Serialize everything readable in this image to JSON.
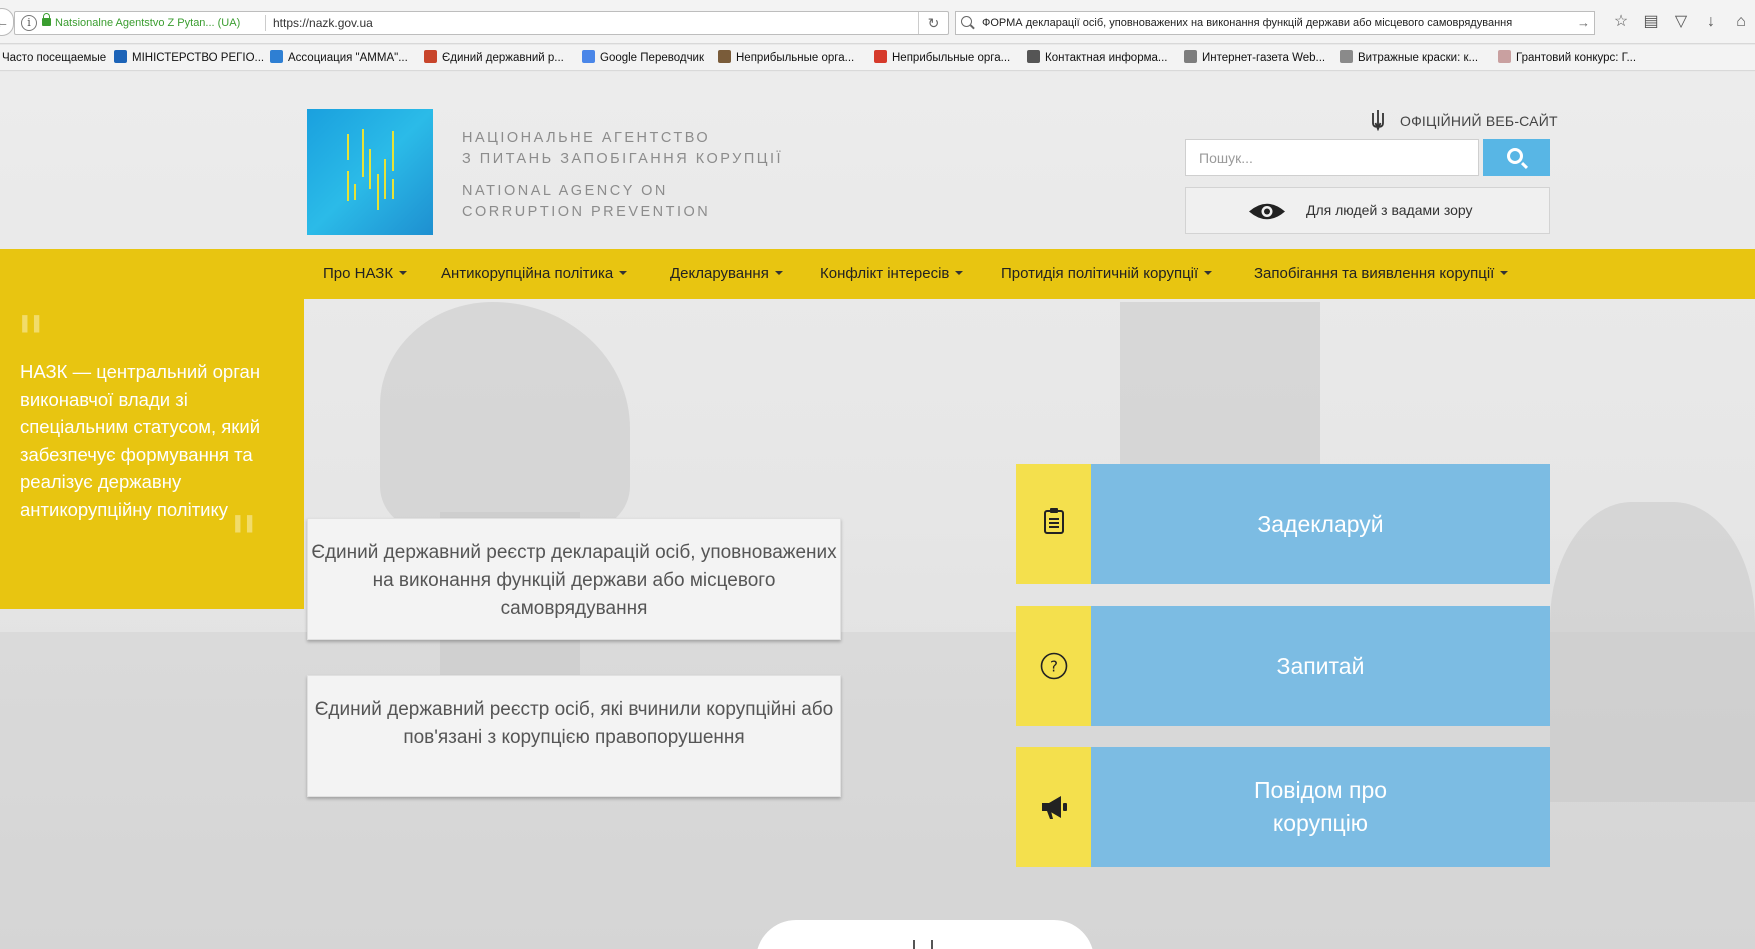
{
  "browser": {
    "back_glyph": "←",
    "site_identity": "Natsionalne Agentstvo Z Pytan... (UA)",
    "url": "https://nazk.gov.ua",
    "reload_glyph": "↻",
    "search_text": "ФОРМА декларації осіб, уповноважених на виконання функцій держави або місцевого самоврядування",
    "search_go": "→",
    "toolbar_icons": [
      {
        "name": "bookmark-star-icon",
        "glyph": "☆"
      },
      {
        "name": "reading-list-icon",
        "glyph": "▤"
      },
      {
        "name": "pocket-icon",
        "glyph": "▽"
      },
      {
        "name": "download-icon",
        "glyph": "↓"
      },
      {
        "name": "home-icon",
        "glyph": "⌂"
      }
    ],
    "bookmarks": [
      {
        "label": "Часто посещаемые",
        "color": ""
      },
      {
        "label": "МІНІСТЕРСТВО РЕГІО...",
        "color": "#1c63b7"
      },
      {
        "label": "Ассоциация \"АММА\"...",
        "color": "#2e7fd3"
      },
      {
        "label": "Єдиний державний р...",
        "color": "#c8452b"
      },
      {
        "label": "Google Переводчик",
        "color": "#4a86e8"
      },
      {
        "label": "Неприбыльные орга...",
        "color": "#7a5c3a"
      },
      {
        "label": "Неприбыльные орга...",
        "color": "#d63a2b"
      },
      {
        "label": "Контактная информа...",
        "color": "#555555"
      },
      {
        "label": "Интернет-газета Web...",
        "color": "#7d7d7d"
      },
      {
        "label": "Витражные краски: к...",
        "color": "#8a8a8a"
      },
      {
        "label": "Грантовий конкурс: Г...",
        "color": "#c9a0a0"
      }
    ]
  },
  "header": {
    "logo_line1": "НАЦІОНАЛЬНЕ АГЕНТСТВО",
    "logo_line2": "З ПИТАНЬ ЗАПОБІГАННЯ КОРУПЦІЇ",
    "logo_line3": "NATIONAL AGENCY ON",
    "logo_line4": "CORRUPTION PREVENTION",
    "official_label": "ОФІЦІЙНИЙ ВЕБ-САЙТ",
    "search_placeholder": "Пошук...",
    "vision_label": "Для людей з вадами зору"
  },
  "nav": {
    "items": [
      "Про НАЗК",
      "Антикорупційна політика",
      "Декларування",
      "Конфлікт інтересів",
      "Протидія політичній корупції",
      "Запобігання та виявлення корупції"
    ]
  },
  "quote": {
    "open_mark": "\"",
    "close_mark": "\"",
    "text": "НАЗК — центральний орган  виконавчої влади зі спеціальним статусом, який забезпечує формування та реалізує державну антикорупційну політику"
  },
  "registries": [
    "Єдиний державний реєстр декларацій осіб, уповноважених на виконання функцій держави або місцевого самоврядування",
    "Єдиний державний реєстр осіб, які вчинили корупційні або пов'язані з корупцією правопорушення"
  ],
  "actions": [
    {
      "label": "Задекларуй",
      "icon": "clipboard-icon"
    },
    {
      "label": "Запитай",
      "icon": "question-circle-icon"
    },
    {
      "label": "Повідом про корупцію",
      "icon": "megaphone-icon"
    }
  ],
  "colors": {
    "brand_yellow": "#e8c511",
    "action_blue": "#7cbce3",
    "action_yellow": "#f4e04d",
    "search_blue": "#58b6e5",
    "logo_blue": "#1aa0de"
  }
}
